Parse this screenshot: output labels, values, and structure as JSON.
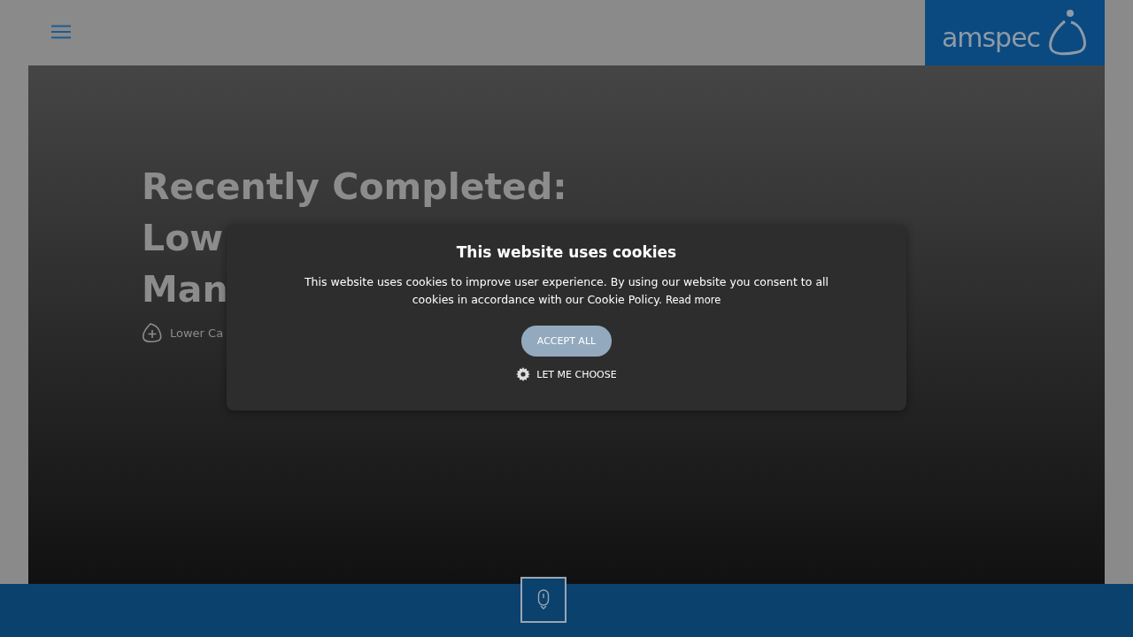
{
  "header": {
    "logo_text": "amspec"
  },
  "hero": {
    "title_lines": [
      "Recently Completed:",
      "Low",
      "Man"
    ],
    "tag": "Lower Ca"
  },
  "cookie_dialog": {
    "title": "This website uses cookies",
    "body": "This website uses cookies to improve user experience. By using our website you consent to all cookies in accordance with our Cookie Policy.",
    "link": "Read more",
    "accept_button": "ACCEPT ALL",
    "choose_button": "LET ME CHOOSE"
  }
}
